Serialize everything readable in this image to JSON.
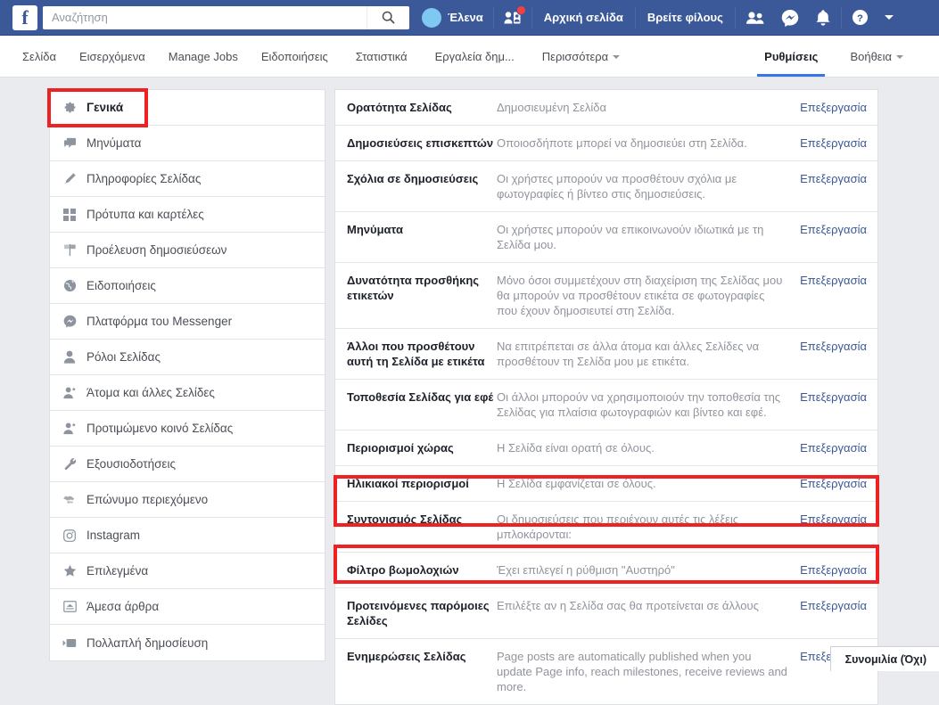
{
  "topbar": {
    "logo": "f",
    "search": {
      "value": "",
      "placeholder": "Αναζήτηση"
    },
    "search_icon": "search-icon",
    "user_name": "Έλενα",
    "home_label": "Αρχική σελίδα",
    "find_friends_label": "Βρείτε φίλους",
    "icons": {
      "friend_requests": "friend-requests-icon",
      "friends": "friends-icon",
      "messenger": "messenger-icon",
      "notifications": "bell-icon",
      "help": "help-icon",
      "account": "chevron-down-icon"
    },
    "bg_color": "#3b5998"
  },
  "subnav": {
    "items": [
      {
        "label": "Σελίδα",
        "active": false,
        "caret": false
      },
      {
        "label": "Εισερχόμενα",
        "active": false,
        "caret": false
      },
      {
        "label": "Manage Jobs",
        "active": false,
        "caret": false
      },
      {
        "label": "Ειδοποιήσεις",
        "active": false,
        "caret": false
      },
      {
        "label": "Στατιστικά",
        "active": false,
        "caret": false
      },
      {
        "label": "Εργαλεία δημ...",
        "active": false,
        "caret": false
      },
      {
        "label": "Περισσότερα",
        "active": false,
        "caret": true
      }
    ],
    "right_items": [
      {
        "label": "Ρυθμίσεις",
        "active": true,
        "caret": false
      },
      {
        "label": "Βοήθεια",
        "active": false,
        "caret": true
      }
    ],
    "active_underline_color": "#3578e5"
  },
  "sidebar": {
    "items": [
      {
        "label": "Γενικά",
        "icon": "gear-icon",
        "selected": true
      },
      {
        "label": "Μηνύματα",
        "icon": "message-icon",
        "selected": false
      },
      {
        "label": "Πληροφορίες Σελίδας",
        "icon": "pencil-icon",
        "selected": false
      },
      {
        "label": "Πρότυπα και καρτέλες",
        "icon": "grid-icon",
        "selected": false
      },
      {
        "label": "Προέλευση δημοσιεύσεων",
        "icon": "flag-icon",
        "selected": false
      },
      {
        "label": "Ειδοποιήσεις",
        "icon": "globe-icon",
        "selected": false
      },
      {
        "label": "Πλατφόρμα του Messenger",
        "icon": "messenger-icon",
        "selected": false
      },
      {
        "label": "Ρόλοι Σελίδας",
        "icon": "person-icon",
        "selected": false
      },
      {
        "label": "Άτομα και άλλες Σελίδες",
        "icon": "person-star-icon",
        "selected": false
      },
      {
        "label": "Προτιμώμενο κοινό Σελίδας",
        "icon": "person-star-icon",
        "selected": false
      },
      {
        "label": "Εξουσιοδοτήσεις",
        "icon": "wrench-icon",
        "selected": false
      },
      {
        "label": "Επώνυμο περιεχόμενο",
        "icon": "handshake-icon",
        "selected": false
      },
      {
        "label": "Instagram",
        "icon": "instagram-icon",
        "selected": false
      },
      {
        "label": "Επιλεγμένα",
        "icon": "star-icon",
        "selected": false
      },
      {
        "label": "Άμεσα άρθρα",
        "icon": "article-icon",
        "selected": false
      },
      {
        "label": "Πολλαπλή δημοσίευση",
        "icon": "video-icon",
        "selected": false
      }
    ],
    "highlight_color": "#ee2222"
  },
  "main": {
    "edit_label": "Επεξεργασία",
    "rows": [
      {
        "title": "Ορατότητα Σελίδας",
        "desc": "Δημοσιευμένη Σελίδα",
        "edit": "Επεξεργασία",
        "highlight": false
      },
      {
        "title": "Δημοσιεύσεις επισκεπτών",
        "desc": "Οποιοσδήποτε μπορεί να δημοσιεύει στη Σελίδα.",
        "edit": "Επεξεργασία",
        "highlight": false
      },
      {
        "title": "Σχόλια σε δημοσιεύσεις",
        "desc": "Οι χρήστες μπορούν να προσθέτουν σχόλια με φωτογραφίες ή βίντεο στις δημοσιεύσεις.",
        "edit": "Επεξεργασία",
        "highlight": false
      },
      {
        "title": "Μηνύματα",
        "desc": "Οι χρήστες μπορούν να επικοινωνούν ιδιωτικά με τη Σελίδα μου.",
        "edit": "Επεξεργασία",
        "highlight": false
      },
      {
        "title": "Δυνατότητα προσθήκης ετικετών",
        "desc": "Μόνο όσοι συμμετέχουν στη διαχείριση της Σελίδας μου θα μπορούν να προσθέτουν ετικέτα σε φωτογραφίες που έχουν δημοσιευτεί στη Σελίδα.",
        "edit": "Επεξεργασία",
        "highlight": false
      },
      {
        "title": "Άλλοι που προσθέτουν αυτή τη Σελίδα με ετικέτα",
        "desc": "Να επιτρέπεται σε άλλα άτομα και άλλες Σελίδες να προσθέτουν τη Σελίδα μου με ετικέτα.",
        "edit": "Επεξεργασία",
        "highlight": false
      },
      {
        "title": "Τοποθεσία Σελίδας για εφέ",
        "desc": "Οι άλλοι μπορούν να χρησιμοποιούν την τοποθεσία της Σελίδας για πλαίσια φωτογραφιών και βίντεο και εφέ.",
        "edit": "Επεξεργασία",
        "highlight": false
      },
      {
        "title": "Περιορισμοί χώρας",
        "desc": "Η Σελίδα είναι ορατή σε όλους.",
        "edit": "Επεξεργασία",
        "highlight": false
      },
      {
        "title": "Ηλικιακοί περιορισμοί",
        "desc": "Η Σελίδα εμφανίζεται σε όλους.",
        "edit": "Επεξεργασία",
        "highlight": false
      },
      {
        "title": "Συντονισμός Σελίδας",
        "desc": "Οι δημοσιεύσεις που περιέχουν αυτές τις λέξεις μπλοκάρονται:",
        "edit": "Επεξεργασία",
        "highlight": true
      },
      {
        "title": "Φίλτρο βωμολοχιών",
        "desc": "Έχει επιλεγεί η ρύθμιση \"Αυστηρό\"",
        "edit": "Επεξεργασία",
        "highlight": true
      },
      {
        "title": "Προτεινόμενες παρόμοιες Σελίδες",
        "desc": "Επιλέξτε αν η Σελίδα σας θα προτείνεται σε άλλους",
        "edit": "Επεξεργασία",
        "highlight": false
      },
      {
        "title": "Ενημερώσεις Σελίδας",
        "desc": "Page posts are automatically published when you update Page info, reach milestones, receive reviews and more.",
        "edit": "Επεξεργασία",
        "highlight": false
      }
    ]
  },
  "chatbar": {
    "label": "Συνομιλία (Όχι)"
  }
}
